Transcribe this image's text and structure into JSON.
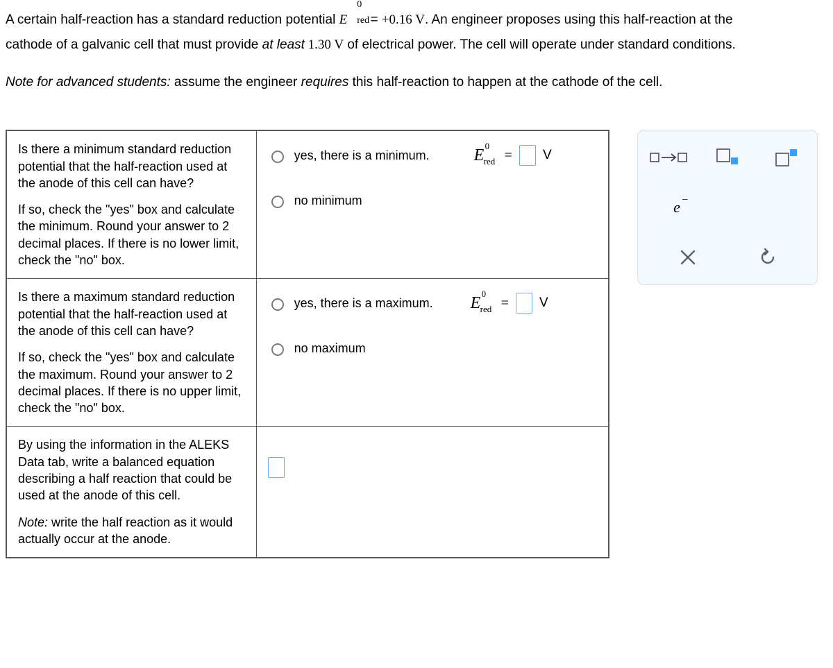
{
  "problem": {
    "line1_a": "A certain half-reaction has a standard reduction potential ",
    "e_symbol": "E",
    "e_super": "0",
    "e_sub": "red",
    "equals": " = ",
    "value": "+0.16",
    "unit_v": " V",
    "line1_b": ". An engineer proposes using this half-reaction at the",
    "line2_a": "cathode of a galvanic cell that must provide ",
    "at_least": "at least",
    "voltage_req": " 1.30 V",
    "line2_b": " of electrical power. The cell will operate under standard conditions.",
    "note_label": "Note for advanced students:",
    "note_a": " assume the engineer ",
    "requires": "requires",
    "note_b": " this half-reaction to happen at the cathode of the cell."
  },
  "rows": {
    "min": {
      "q1": "Is there a minimum standard reduction potential that the half-reaction used at the anode of this cell can have?",
      "q2": "If so, check the \"yes\" box and calculate the minimum. Round your answer to 2 decimal places. If there is no lower limit, check the \"no\" box.",
      "yes": "yes, there is a minimum.",
      "no": "no minimum",
      "eq_super": "0",
      "eq_sub": "red",
      "eq_unit": "V"
    },
    "max": {
      "q1": "Is there a maximum standard reduction potential that the half-reaction used at the anode of this cell can have?",
      "q2": "If so, check the \"yes\" box and calculate the maximum. Round your answer to 2 decimal places. If there is no upper limit, check the \"no\" box.",
      "yes": "yes, there is a maximum.",
      "no": "no maximum",
      "eq_super": "0",
      "eq_sub": "red",
      "eq_unit": "V"
    },
    "eqn": {
      "q1": "By using the information in the ALEKS Data tab, write a balanced equation describing a half reaction that could be used at the anode of this cell.",
      "note_label": "Note:",
      "note": " write the half reaction as it would actually occur at the anode."
    }
  },
  "palette": {
    "yields": "yields-icon",
    "subscript": "subscript-icon",
    "superscript": "superscript-icon",
    "electron": "e⁻",
    "clear": "×",
    "reset": "↺"
  }
}
